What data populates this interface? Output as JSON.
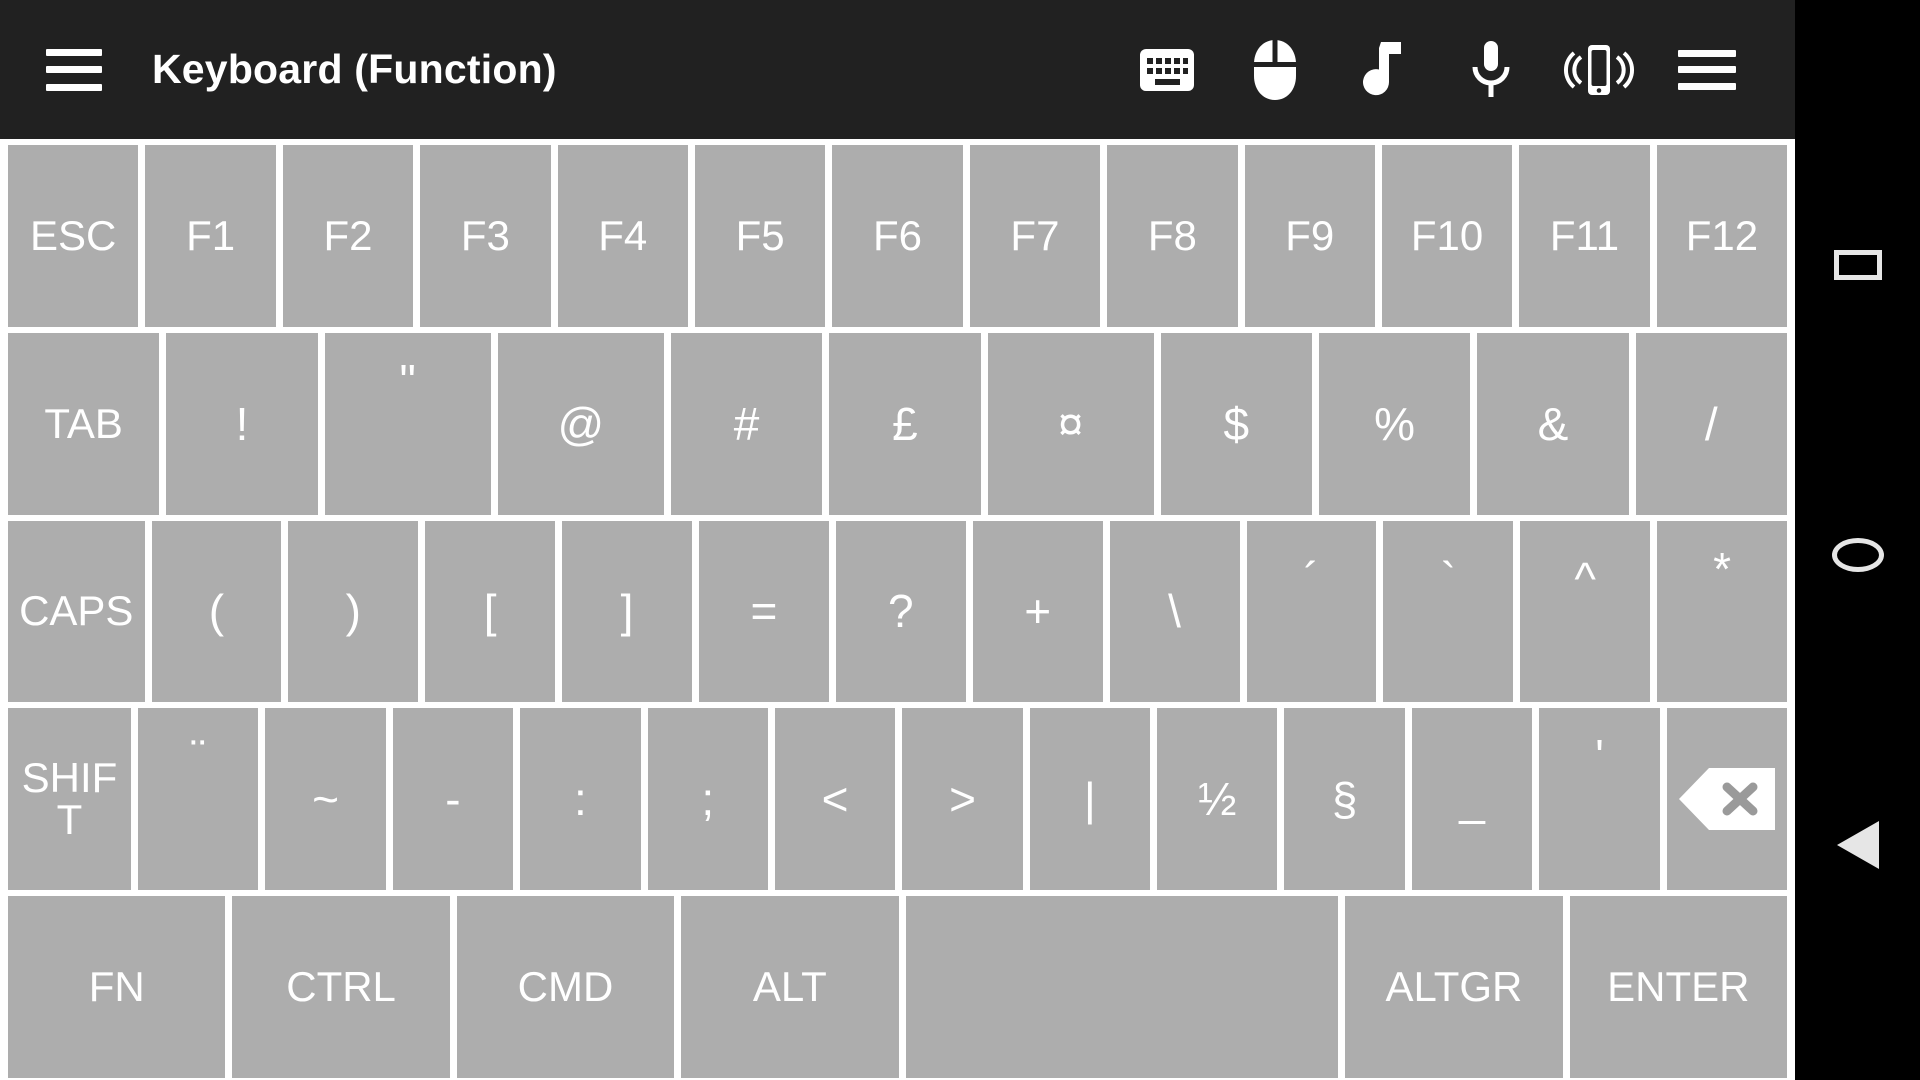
{
  "appbar": {
    "menu_icon": "hamburger-menu-icon",
    "title": "Keyboard (Function)",
    "actions": [
      {
        "icon": "keyboard-icon",
        "label": "Keyboard"
      },
      {
        "icon": "mouse-icon",
        "label": "Mouse"
      },
      {
        "icon": "music-note-icon",
        "label": "Media"
      },
      {
        "icon": "microphone-icon",
        "label": "Voice"
      },
      {
        "icon": "vibrate-phone-icon",
        "label": "Vibrate"
      },
      {
        "icon": "overflow-menu-icon",
        "label": "More options"
      }
    ],
    "background_color": "#212121",
    "text_color": "#ffffff"
  },
  "keyboard": {
    "key_color": "#adadad",
    "key_text_color": "#ffffff",
    "background_color": "#ffffff",
    "rows": [
      {
        "name": "function-row",
        "keys": [
          {
            "label": "ESC",
            "style": "mod",
            "flex": 1
          },
          {
            "label": "F1",
            "style": "mod",
            "flex": 1
          },
          {
            "label": "F2",
            "style": "mod",
            "flex": 1
          },
          {
            "label": "F3",
            "style": "mod",
            "flex": 1
          },
          {
            "label": "F4",
            "style": "mod",
            "flex": 1
          },
          {
            "label": "F5",
            "style": "mod",
            "flex": 1
          },
          {
            "label": "F6",
            "style": "mod",
            "flex": 1
          },
          {
            "label": "F7",
            "style": "mod",
            "flex": 1
          },
          {
            "label": "F8",
            "style": "mod",
            "flex": 1
          },
          {
            "label": "F9",
            "style": "mod",
            "flex": 1
          },
          {
            "label": "F10",
            "style": "mod",
            "flex": 1
          },
          {
            "label": "F11",
            "style": "mod",
            "flex": 1
          },
          {
            "label": "F12",
            "style": "mod",
            "flex": 1
          }
        ]
      },
      {
        "name": "number-symbol-row",
        "keys": [
          {
            "label": "TAB",
            "style": "mod",
            "flex": 1
          },
          {
            "label": "!",
            "style": "sym",
            "flex": 1
          },
          {
            "label": "\"",
            "style": "sym raise2",
            "flex": 1.1
          },
          {
            "label": "@",
            "style": "sym",
            "flex": 1.1
          },
          {
            "label": "#",
            "style": "sym",
            "flex": 1
          },
          {
            "label": "£",
            "style": "sym",
            "flex": 1
          },
          {
            "label": "¤",
            "style": "sym",
            "flex": 1.1
          },
          {
            "label": "$",
            "style": "sym",
            "flex": 1
          },
          {
            "label": "%",
            "style": "sym",
            "flex": 1
          },
          {
            "label": "&",
            "style": "sym",
            "flex": 1
          },
          {
            "label": "/",
            "style": "sym",
            "flex": 1
          }
        ]
      },
      {
        "name": "bracket-row",
        "keys": [
          {
            "label": "CAPS",
            "style": "mod",
            "flex": 1
          },
          {
            "label": "(",
            "style": "sym",
            "flex": 0.95
          },
          {
            "label": ")",
            "style": "sym",
            "flex": 0.95
          },
          {
            "label": "[",
            "style": "sym",
            "flex": 0.95
          },
          {
            "label": "]",
            "style": "sym",
            "flex": 0.95
          },
          {
            "label": "=",
            "style": "sym",
            "flex": 0.95
          },
          {
            "label": "?",
            "style": "sym",
            "flex": 0.95
          },
          {
            "label": "+",
            "style": "sym",
            "flex": 0.95
          },
          {
            "label": "\\",
            "style": "sym",
            "flex": 0.95
          },
          {
            "label": "´",
            "style": "sym raise",
            "flex": 0.95
          },
          {
            "label": "`",
            "style": "sym raise",
            "flex": 0.95
          },
          {
            "label": "^",
            "style": "sym raise",
            "flex": 0.95
          },
          {
            "label": "*",
            "style": "sym raise2",
            "flex": 0.95
          }
        ]
      },
      {
        "name": "shift-row",
        "keys": [
          {
            "label": "SHIFT",
            "style": "shift-key",
            "flex": 0.92
          },
          {
            "label": "¨",
            "style": "sym raise2",
            "flex": 0.9
          },
          {
            "label": "~",
            "style": "sym",
            "flex": 0.9
          },
          {
            "label": "-",
            "style": "sym",
            "flex": 0.9
          },
          {
            "label": ":",
            "style": "sym",
            "flex": 0.9
          },
          {
            "label": ";",
            "style": "sym",
            "flex": 0.9
          },
          {
            "label": "<",
            "style": "sym",
            "flex": 0.9
          },
          {
            "label": ">",
            "style": "sym",
            "flex": 0.9
          },
          {
            "label": "|",
            "style": "sym",
            "flex": 0.9
          },
          {
            "label": "½",
            "style": "sym",
            "flex": 0.9
          },
          {
            "label": "§",
            "style": "sym",
            "flex": 0.9
          },
          {
            "label": "_",
            "style": "sym",
            "flex": 0.9
          },
          {
            "label": "'",
            "style": "sym raise2",
            "flex": 0.9
          },
          {
            "label": "",
            "style": "backspace",
            "flex": 0.9,
            "icon": "backspace-icon"
          }
        ]
      },
      {
        "name": "bottom-modifier-row",
        "keys": [
          {
            "label": "FN",
            "style": "mod",
            "flex": 1.12
          },
          {
            "label": "CTRL",
            "style": "mod",
            "flex": 1.12
          },
          {
            "label": "CMD",
            "style": "mod",
            "flex": 1.12
          },
          {
            "label": "ALT",
            "style": "mod",
            "flex": 1.12
          },
          {
            "label": "",
            "style": "mod",
            "flex": 2.25,
            "icon": "space-bar"
          },
          {
            "label": "ALTGR",
            "style": "mod",
            "flex": 1.12
          },
          {
            "label": "ENTER",
            "style": "mod",
            "flex": 1.12
          }
        ]
      }
    ]
  },
  "navbar": {
    "background_color": "#000000",
    "buttons": [
      {
        "icon": "recents-square-icon",
        "label": "Recents"
      },
      {
        "icon": "home-circle-icon",
        "label": "Home"
      },
      {
        "icon": "back-triangle-icon",
        "label": "Back"
      }
    ]
  }
}
